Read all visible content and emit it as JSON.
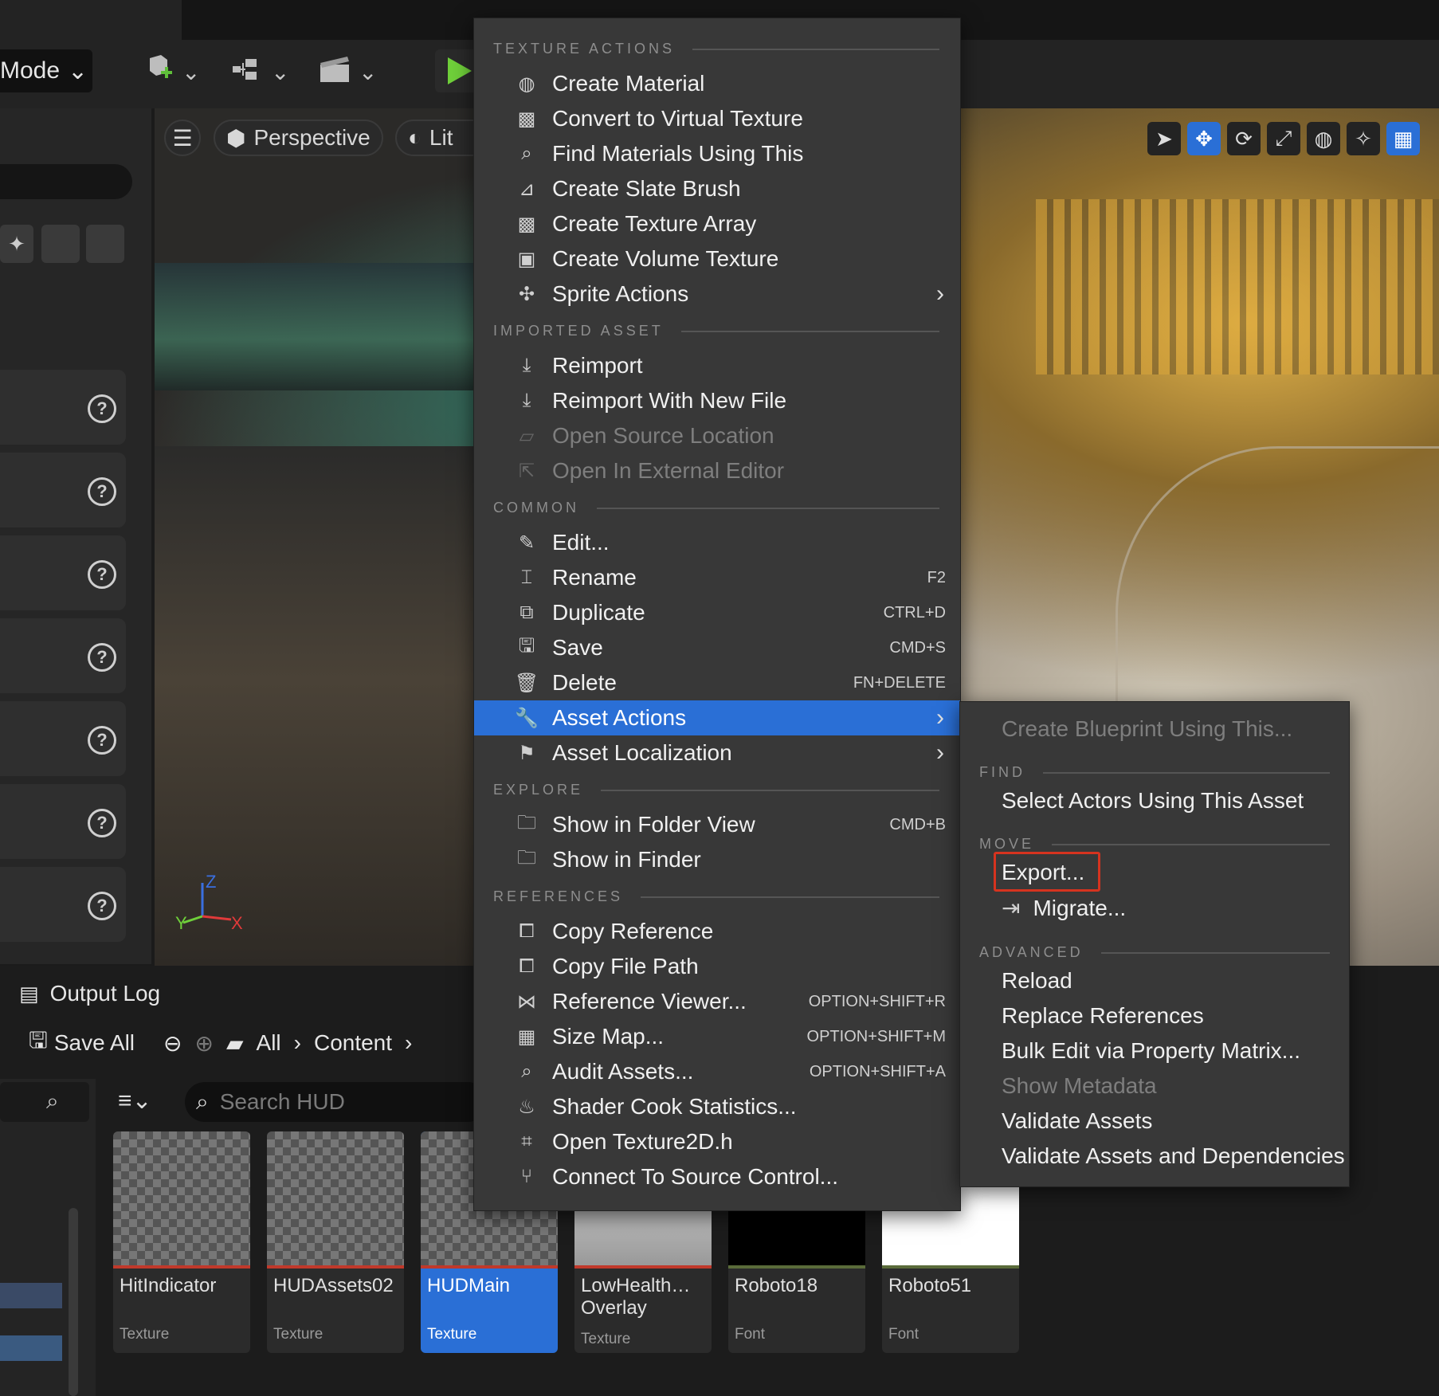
{
  "toolbar": {
    "mode_label": "Mode",
    "play_color": "#6fcf3a"
  },
  "viewport": {
    "perspective_label": "Perspective",
    "lit_label": "Lit",
    "axis": {
      "z": "Z",
      "y": "Y",
      "x": "X"
    }
  },
  "bottom": {
    "output_log_label": "Output Log",
    "save_all_label": "Save All",
    "breadcrumb": [
      "All",
      "Content"
    ],
    "search_placeholder": "Search HUD"
  },
  "assets": [
    {
      "name": "HitIndicator",
      "type": "Texture",
      "selected": false
    },
    {
      "name": "HUDAssets02",
      "type": "Texture",
      "selected": false
    },
    {
      "name": "HUDMain",
      "type": "Texture",
      "selected": true
    },
    {
      "name": "LowHealth…\nOverlay",
      "type": "Texture",
      "selected": false
    },
    {
      "name": "Roboto18",
      "type": "Font",
      "selected": false
    },
    {
      "name": "Roboto51",
      "type": "Font",
      "selected": false
    }
  ],
  "menu": {
    "sections": {
      "texture_actions": "TEXTURE ACTIONS",
      "imported_asset": "IMPORTED ASSET",
      "common": "COMMON",
      "explore": "EXPLORE",
      "references": "REFERENCES"
    },
    "items": {
      "create_material": "Create Material",
      "convert_virtual": "Convert to Virtual Texture",
      "find_materials": "Find Materials Using This",
      "create_slate": "Create Slate Brush",
      "create_texture_array": "Create Texture Array",
      "create_volume": "Create Volume Texture",
      "sprite_actions": "Sprite Actions",
      "reimport": "Reimport",
      "reimport_new": "Reimport With New File",
      "open_source": "Open Source Location",
      "open_external": "Open In External Editor",
      "edit": "Edit...",
      "rename": "Rename",
      "rename_sc": "F2",
      "duplicate": "Duplicate",
      "duplicate_sc": "CTRL+D",
      "save": "Save",
      "save_sc": "CMD+S",
      "delete": "Delete",
      "delete_sc": "FN+DELETE",
      "asset_actions": "Asset Actions",
      "asset_localization": "Asset Localization",
      "show_folder": "Show in Folder View",
      "show_folder_sc": "CMD+B",
      "show_finder": "Show in Finder",
      "copy_reference": "Copy Reference",
      "copy_file_path": "Copy File Path",
      "reference_viewer": "Reference Viewer...",
      "reference_viewer_sc": "OPTION+SHIFT+R",
      "size_map": "Size Map...",
      "size_map_sc": "OPTION+SHIFT+M",
      "audit_assets": "Audit Assets...",
      "audit_assets_sc": "OPTION+SHIFT+A",
      "shader_cook": "Shader Cook Statistics...",
      "open_texture2d": "Open Texture2D.h",
      "connect_source": "Connect To Source Control..."
    }
  },
  "submenu": {
    "sections": {
      "find": "FIND",
      "move": "MOVE",
      "advanced": "ADVANCED"
    },
    "items": {
      "create_blueprint": "Create Blueprint Using This...",
      "select_actors": "Select Actors Using This Asset",
      "export": "Export...",
      "migrate": "Migrate...",
      "reload": "Reload",
      "replace_refs": "Replace References",
      "bulk_edit": "Bulk Edit via Property Matrix...",
      "show_metadata": "Show Metadata",
      "validate": "Validate Assets",
      "validate_deps": "Validate Assets and Dependencies"
    }
  },
  "colors": {
    "accent": "#2a6fd6",
    "highlight_box": "#d6331f"
  }
}
